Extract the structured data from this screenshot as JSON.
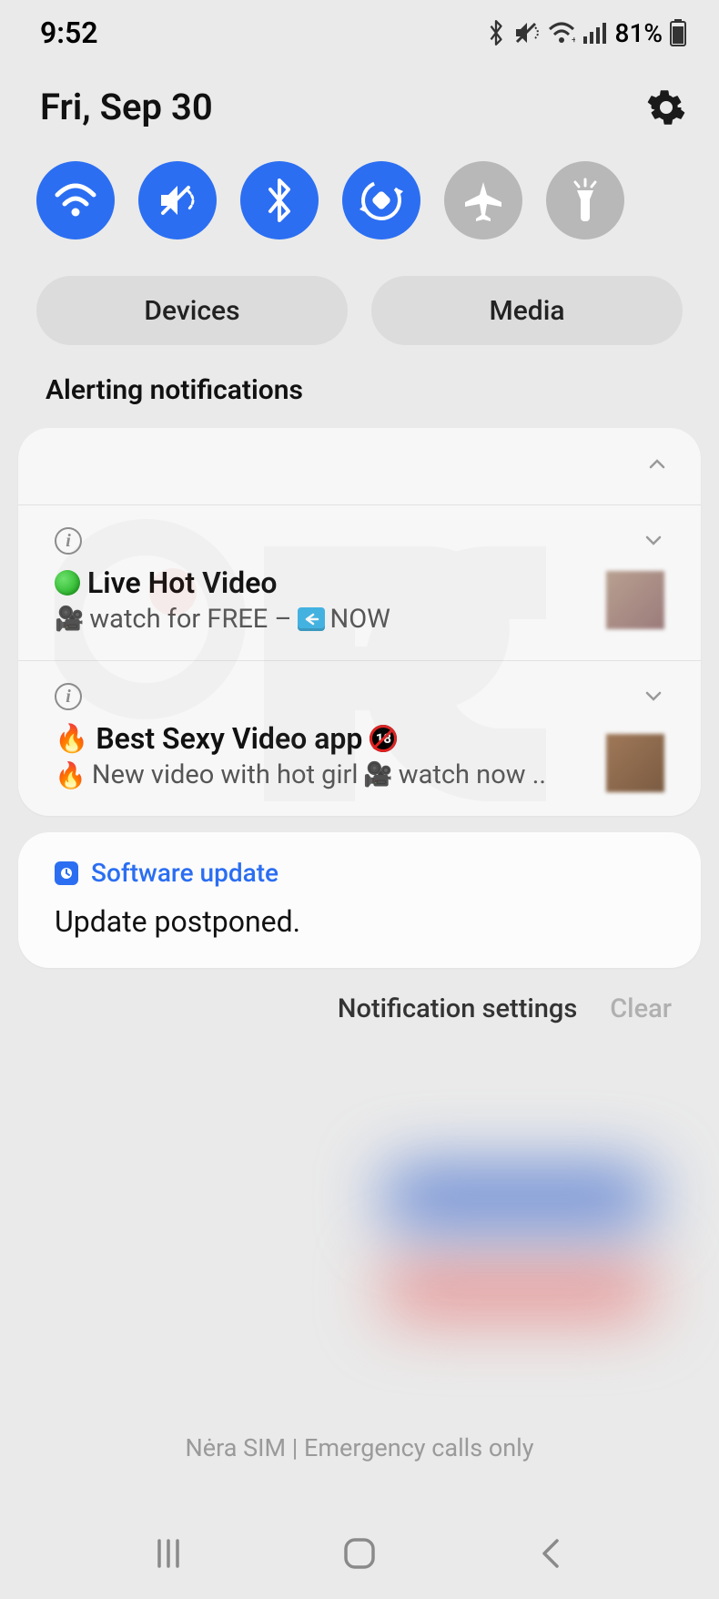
{
  "statusbar": {
    "time": "9:52",
    "battery_text": "81%"
  },
  "header": {
    "date": "Fri, Sep 30"
  },
  "quick_settings": {
    "toggles": [
      {
        "name": "wifi",
        "active": true
      },
      {
        "name": "mute-vibrate",
        "active": true
      },
      {
        "name": "bluetooth",
        "active": true
      },
      {
        "name": "auto-rotate",
        "active": true
      },
      {
        "name": "airplane",
        "active": false
      },
      {
        "name": "flashlight",
        "active": false
      }
    ],
    "pills": {
      "devices": "Devices",
      "media": "Media"
    }
  },
  "section_title": "Alerting notifications",
  "notifications": [
    {
      "title_pre_emoji": "green-dot",
      "title": "Live Hot Video",
      "subtitle_prefix": "🎥",
      "subtitle_text_a": "watch for FREE –",
      "subtitle_mid": "arrow-left-box",
      "subtitle_text_b": "NOW"
    },
    {
      "title_pre_emoji": "🔥",
      "title": "Best Sexy Video app",
      "title_post_emoji": "no18",
      "subtitle_prefix": "🔥",
      "subtitle_text_a": "New video with hot girl",
      "subtitle_mid": "🎥",
      "subtitle_text_b": "watch now .."
    }
  ],
  "software_update": {
    "label": "Software update",
    "body": "Update postponed."
  },
  "footer": {
    "settings": "Notification settings",
    "clear": "Clear"
  },
  "sim_status": "Nėra SIM | Emergency calls only"
}
